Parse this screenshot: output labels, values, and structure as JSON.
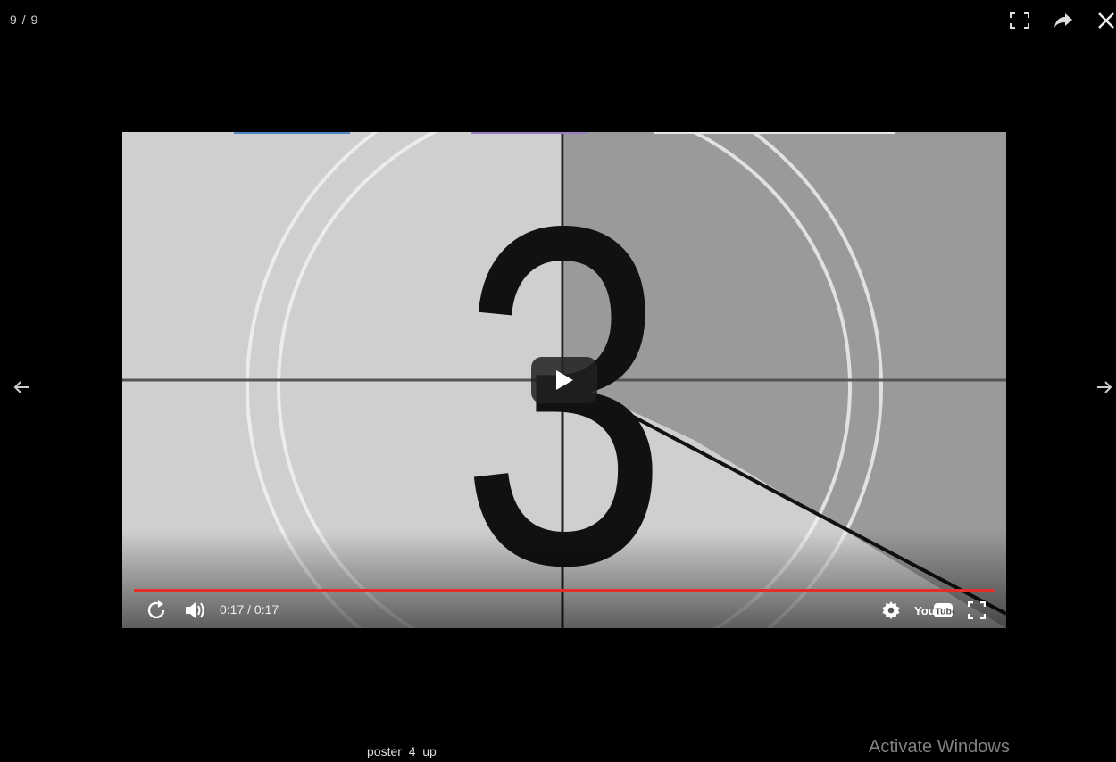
{
  "gallery": {
    "counter": "9 / 9",
    "caption": "poster_4_up"
  },
  "toolbar": {
    "fullscreen_icon": "fullscreen-icon",
    "share_icon": "share-icon",
    "close_icon": "close-icon"
  },
  "navigation": {
    "prev_icon": "arrow-left-icon",
    "next_icon": "arrow-right-icon"
  },
  "video": {
    "countdown_digit": "3",
    "time": "0:17 / 0:17",
    "progress": 1.0,
    "progress_color": "#e52d27",
    "youtube_logo_you": "You",
    "youtube_logo_tube": "Tube"
  },
  "system": {
    "watermark": "Activate Windows"
  }
}
